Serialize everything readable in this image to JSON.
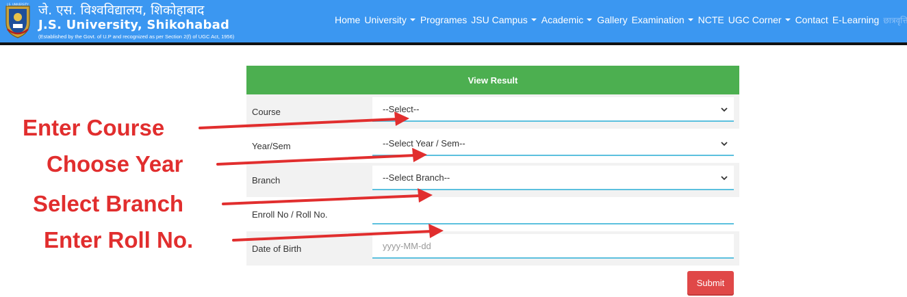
{
  "header": {
    "brand_hindi": "जे. एस. विश्वविद्यालय, शिकोहाबाद",
    "brand_name": "J.S. University, Shikohabad",
    "brand_established": "(Established by the Govt. of U.P and recognized as per Section 2(f) of UGC Act, 1956)",
    "logo_text": "J.S. UNIVERSITY",
    "colors": {
      "bar": "#3b97f1",
      "line": "#111111"
    }
  },
  "nav": [
    {
      "label": "Home",
      "dropdown": false
    },
    {
      "label": "University",
      "dropdown": true
    },
    {
      "label": "Programes",
      "dropdown": false
    },
    {
      "label": "JSU Campus",
      "dropdown": true
    },
    {
      "label": "Academic",
      "dropdown": true
    },
    {
      "label": "Gallery",
      "dropdown": false
    },
    {
      "label": "Examination",
      "dropdown": true
    },
    {
      "label": "NCTE",
      "dropdown": false
    },
    {
      "label": "UGC Corner",
      "dropdown": true
    },
    {
      "label": "Contact",
      "dropdown": false
    },
    {
      "label": "E-Learning",
      "dropdown": false
    },
    {
      "label": "छात्रवृत्ति",
      "dropdown": false
    }
  ],
  "form": {
    "title": "View Result",
    "course": {
      "label": "Course",
      "selected": "--Select--"
    },
    "year_sem": {
      "label": "Year/Sem",
      "selected": "--Select Year / Sem--"
    },
    "branch": {
      "label": "Branch",
      "selected": "--Select Branch--"
    },
    "enroll": {
      "label": "Enroll No / Roll No.",
      "value": ""
    },
    "dob": {
      "label": "Date of Birth",
      "placeholder": "yyyy-MM-dd"
    },
    "submit_label": "Submit",
    "colors": {
      "header": "#4caf50",
      "underline": "#5bc0de",
      "submit": "#e04848"
    }
  },
  "annotations": {
    "course": "Enter Course",
    "year": "Choose Year",
    "branch": "Select Branch",
    "roll": "Enter Roll No.",
    "color": "#e12e2e"
  }
}
